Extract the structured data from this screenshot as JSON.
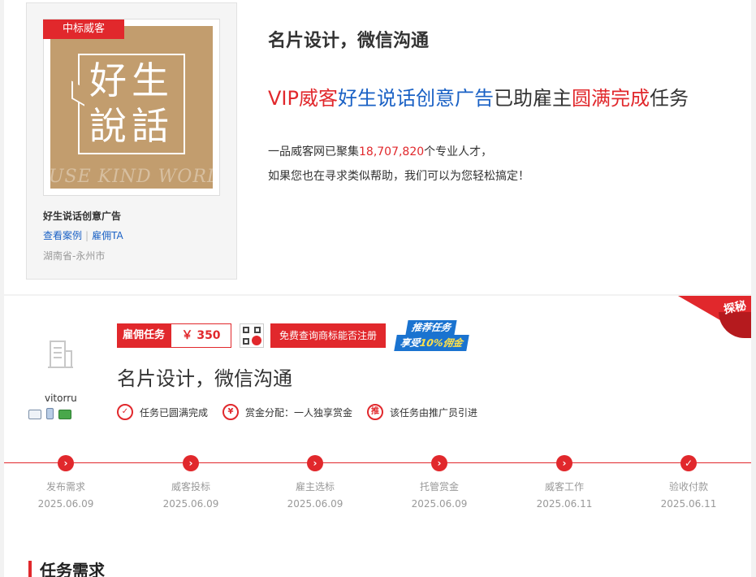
{
  "service_card": {
    "badge": "中标威客",
    "logo_chars": [
      "好",
      "生",
      "說",
      "話"
    ],
    "logo_watermark": "USE KIND WORDS",
    "name": "好生说话创意广告",
    "link_view_cases": "查看案例",
    "link_hire": "雇佣TA",
    "location": "湖南省-永州市"
  },
  "headline": "名片设计，微信沟通",
  "promo": {
    "vip_label": "VIP威客",
    "vendor": "好生说话创意广告",
    "middle": "已助雇主",
    "highlight": "圆满完成",
    "tail": "任务"
  },
  "stats": {
    "line1_prefix": "一品威客网已聚集",
    "talent_count": "18,707,820",
    "line1_suffix": "个专业人才，",
    "line2": "如果您也在寻求类似帮助，我们可以为您轻松搞定！"
  },
  "corner_ribbon": "探秘",
  "employer": {
    "name": "vitorru",
    "verify_icons": [
      "id-card-icon",
      "phone-icon",
      "bank-card-icon"
    ]
  },
  "task": {
    "type": "雇佣任务",
    "price": "￥ 350",
    "trademark_button": "免费查询商标能否注册",
    "promo_badge_line1": "推荐任务",
    "promo_badge_line2_prefix": "享受",
    "promo_badge_line2_highlight": "10%佣金",
    "title": "名片设计，微信沟通",
    "features": [
      {
        "icon": "check-circle-icon",
        "text": "任务已圆满完成"
      },
      {
        "icon": "yen-circle-icon",
        "text": "赏金分配：一人独享赏金"
      },
      {
        "icon": "promote-circle-icon",
        "glyph": "推",
        "text": "该任务由推广员引进"
      }
    ]
  },
  "timeline": [
    {
      "label": "发布需求",
      "date": "2025.06.09",
      "status": "arrow"
    },
    {
      "label": "威客投标",
      "date": "2025.06.09",
      "status": "arrow"
    },
    {
      "label": "雇主选标",
      "date": "2025.06.09",
      "status": "arrow"
    },
    {
      "label": "托管赏金",
      "date": "2025.06.09",
      "status": "arrow"
    },
    {
      "label": "威客工作",
      "date": "2025.06.11",
      "status": "arrow"
    },
    {
      "label": "验收付款",
      "date": "2025.06.11",
      "status": "check"
    }
  ],
  "section_title": "任务需求",
  "colors": {
    "accent_red": "#e1282c",
    "link_blue": "#1a61c5",
    "logo_tan": "#c29d6e"
  }
}
